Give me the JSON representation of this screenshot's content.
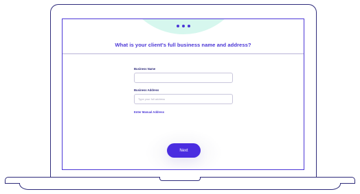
{
  "form": {
    "question": "What is your client's full business name and address?",
    "business_name_label": "Business Name",
    "business_name_value": "",
    "business_address_label": "Business Address",
    "business_address_placeholder": "Type your full address",
    "manual_address_link": "Enter Manual Address",
    "next_button": "Next"
  },
  "progress": {
    "dots": 3
  },
  "colors": {
    "accent": "#4a2de0",
    "frame": "#2d2a7a",
    "hero_blob": "#d6f7ee"
  }
}
